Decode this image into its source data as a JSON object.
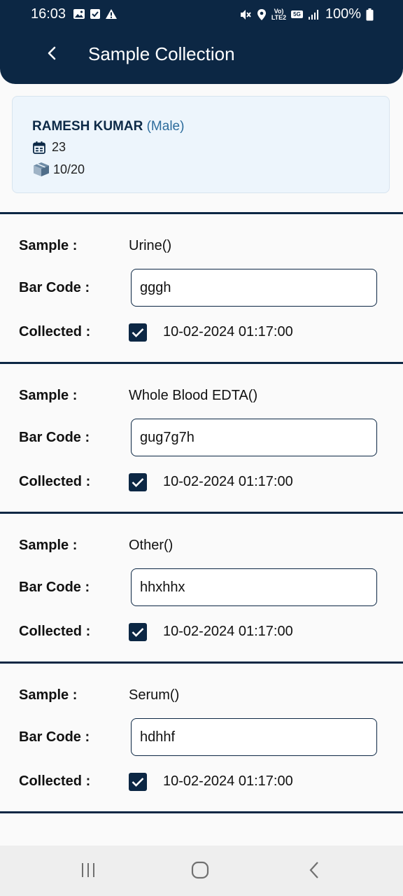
{
  "status_bar": {
    "time": "16:03",
    "battery": "100%",
    "network_top": "Vo)",
    "network_bottom": "LTE2",
    "network_badge": "5G",
    "left_icons": [
      "image-icon",
      "check-square-icon",
      "warning-icon"
    ],
    "right_icons": [
      "mute-icon",
      "location-icon",
      "signal-icon",
      "battery-icon"
    ]
  },
  "header": {
    "title": "Sample Collection",
    "back_icon": "chevron-left-icon"
  },
  "patient": {
    "name": "RAMESH KUMAR",
    "gender": "(Male)",
    "age": "23",
    "sample_ratio": "10/20",
    "age_icon": "calendar-icon",
    "ratio_icon": "boxes-icon"
  },
  "labels": {
    "sample": "Sample :",
    "barcode": "Bar Code :",
    "collected": "Collected :"
  },
  "samples": [
    {
      "name": "Urine()",
      "barcode": "gggh",
      "collected": true,
      "collected_at": "10-02-2024 01:17:00"
    },
    {
      "name": "Whole Blood EDTA()",
      "barcode": "gug7g7h",
      "collected": true,
      "collected_at": "10-02-2024 01:17:00"
    },
    {
      "name": "Other()",
      "barcode": "hhxhhx",
      "collected": true,
      "collected_at": "10-02-2024 01:17:00"
    },
    {
      "name": "Serum()",
      "barcode": "hdhhf",
      "collected": true,
      "collected_at": "10-02-2024 01:17:00"
    }
  ],
  "nav_bar": {
    "icons": [
      "recents-icon",
      "home-icon",
      "back-icon"
    ]
  },
  "colors": {
    "primary": "#0c2744",
    "card_background": "#edf5fc",
    "gender_text": "#2d6c9c",
    "page_background": "#fafafa"
  }
}
